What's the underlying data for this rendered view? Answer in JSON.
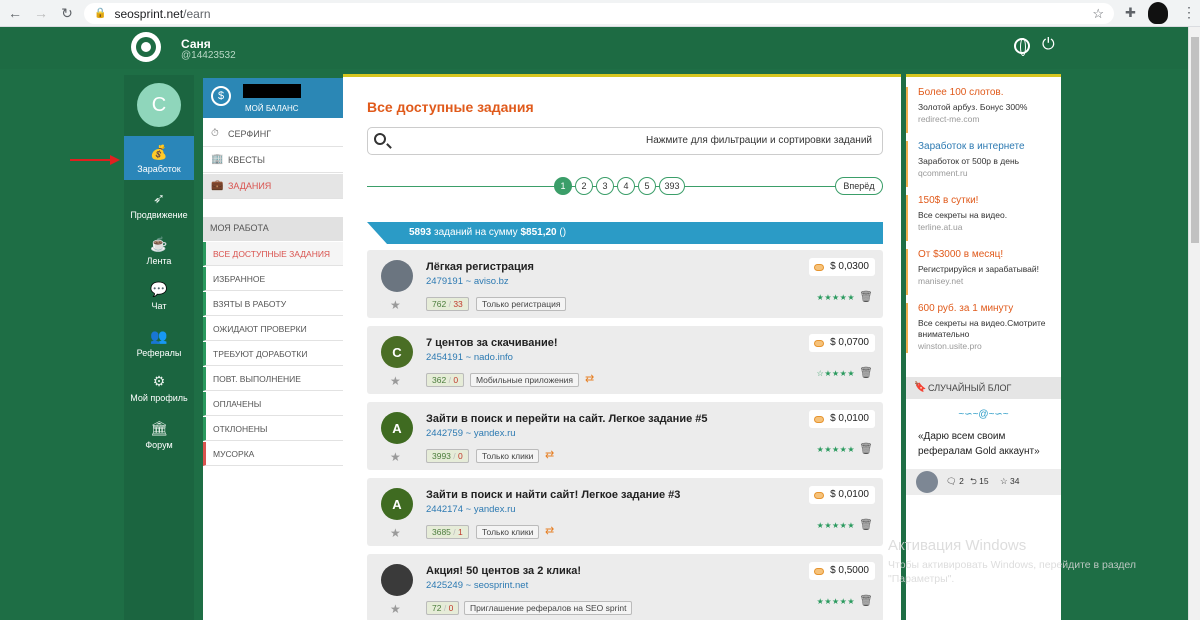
{
  "browser": {
    "url_host": "seosprint.net",
    "url_path": "/earn"
  },
  "header": {
    "username": "Саня",
    "user_id": "@14423532"
  },
  "leftnav": {
    "avatar_letter": "C",
    "items": [
      {
        "label": "Заработок",
        "icon": "money-bag-icon"
      },
      {
        "label": "Продвижение",
        "icon": "rocket-icon"
      },
      {
        "label": "Лента",
        "icon": "cup-icon"
      },
      {
        "label": "Чат",
        "icon": "chat-icon"
      },
      {
        "label": "Рефералы",
        "icon": "users-icon"
      },
      {
        "label": "Мой профиль",
        "icon": "gear-icon"
      },
      {
        "label": "Форум",
        "icon": "forum-icon"
      }
    ]
  },
  "balance": {
    "label": "МОЙ БАЛАНС"
  },
  "submenu": [
    {
      "label": "СЕРФИНГ",
      "icon": "clock-icon"
    },
    {
      "label": "КВЕСТЫ",
      "icon": "building-icon"
    },
    {
      "label": "ЗАДАНИЯ",
      "icon": "briefcase-icon"
    }
  ],
  "mywork": {
    "title": "МОЯ РАБОТА",
    "items": [
      "ВСЕ ДОСТУПНЫЕ ЗАДАНИЯ",
      "ИЗБРАННОЕ",
      "ВЗЯТЫ В РАБОТУ",
      "ОЖИДАЮТ ПРОВЕРКИ",
      "ТРЕБУЮТ ДОРАБОТКИ",
      "ПОВТ. ВЫПОЛНЕНИЕ",
      "ОПЛАЧЕНЫ",
      "ОТКЛОНЕНЫ",
      "МУСОРКА"
    ]
  },
  "main": {
    "title": "Все доступные задания",
    "search_hint": "Нажмите для фильтрации и сортировки заданий",
    "pages": [
      "1",
      "2",
      "3",
      "4",
      "5",
      "393"
    ],
    "next_label": "Вперёд",
    "summary_count": "5893",
    "summary_mid": "заданий на сумму",
    "summary_sum": "$851,20",
    "summary_paren": "()",
    "tasks": [
      {
        "title": "Лёгкая регистрация",
        "id": "2479191",
        "site": "aviso.bz",
        "done": "762",
        "fail": "33",
        "tag": "Только регистрация",
        "price": "$ 0,0300",
        "stars": "★★★★★",
        "avatar_letter": "",
        "avatar_color": "#6b7580",
        "repeat": false
      },
      {
        "title": "7 центов за скачивание!",
        "id": "2454191",
        "site": "nado.info",
        "done": "362",
        "fail": "0",
        "tag": "Мобильные приложения",
        "price": "$ 0,0700",
        "stars": "☆★★★★",
        "avatar_letter": "C",
        "avatar_color": "#4a6e25",
        "repeat": true
      },
      {
        "title": "Зайти в поиск и перейти на сайт. Легкое задание #5",
        "id": "2442759",
        "site": "yandex.ru",
        "done": "3993",
        "fail": "0",
        "tag": "Только клики",
        "price": "$ 0,0100",
        "stars": "★★★★★",
        "avatar_letter": "A",
        "avatar_color": "#3f6b21",
        "repeat": true
      },
      {
        "title": "Зайти в поиск и найти сайт! Легкое задание #3",
        "id": "2442174",
        "site": "yandex.ru",
        "done": "3685",
        "fail": "1",
        "tag": "Только клики",
        "price": "$ 0,0100",
        "stars": "★★★★★",
        "avatar_letter": "A",
        "avatar_color": "#3f6b21",
        "repeat": true
      },
      {
        "title": "Акция! 50 центов за 2 клика!",
        "id": "2425249",
        "site": "seosprint.net",
        "done": "72",
        "fail": "0",
        "tag": "Приглашение рефералов на SEO sprint",
        "price": "$ 0,5000",
        "stars": "★★★★★",
        "avatar_letter": "",
        "avatar_color": "#3a3a3a",
        "repeat": false
      }
    ]
  },
  "ads": [
    {
      "title": "Более 100 слотов.",
      "desc": "Золотой арбуз. Бонус 300%",
      "url": "redirect-me.com",
      "title_color": "orange"
    },
    {
      "title": "Заработок в интернете",
      "desc": "Заработок от 500р в день",
      "url": "qcomment.ru",
      "title_color": "blue"
    },
    {
      "title": "150$ в сутки!",
      "desc": "Все секреты на видео.",
      "url": "terline.at.ua",
      "title_color": "orange"
    },
    {
      "title": "От $3000 в месяц!",
      "desc": "Регистрируйся и зарабатывай!",
      "url": "manisey.net",
      "title_color": "orange"
    },
    {
      "title": "600 руб. за 1 минуту",
      "desc": "Все секреты на видео.Смотрите внимательно",
      "url": "winston.usite.pro",
      "title_color": "orange"
    }
  ],
  "blog": {
    "head": "СЛУЧАЙНЫЙ БЛОГ",
    "ornament": "~∽~@~∽~",
    "quote": "«Дарю всем своим рефералам Gold аккаунт»",
    "comments": "2",
    "replies": "15",
    "likes": "34"
  },
  "watermark": {
    "title": "Активация Windows",
    "sub": "Чтобы активировать Windows, перейдите в раздел \"Параметры\"."
  },
  "colors": {
    "green": "#1d6b43",
    "accent_blue": "#2b87b5",
    "orange_title": "#e05a1b"
  }
}
